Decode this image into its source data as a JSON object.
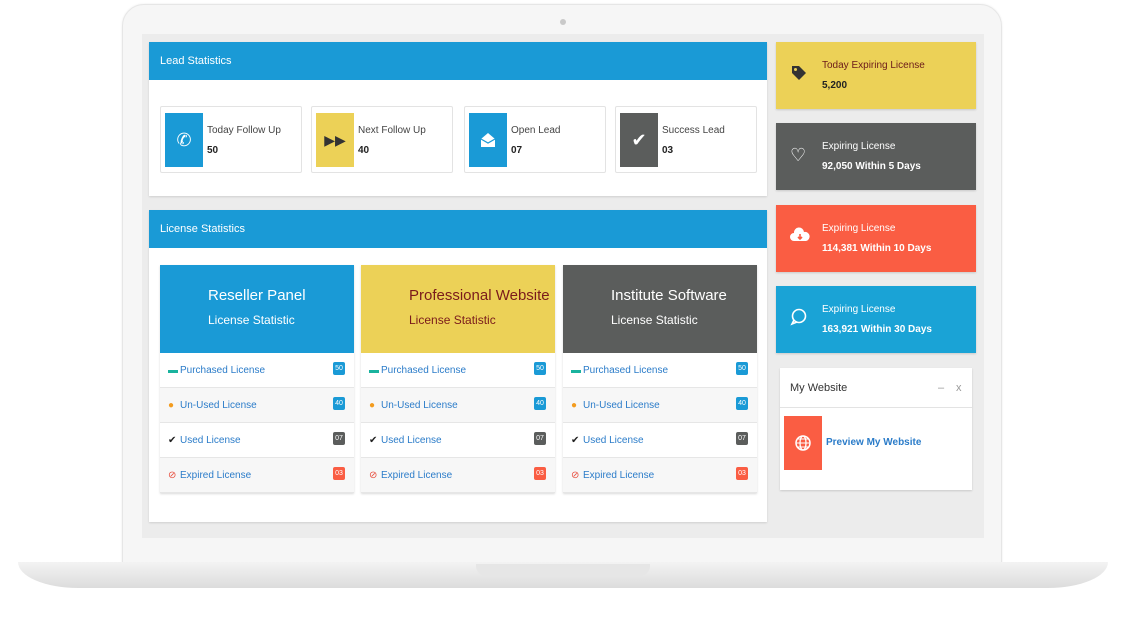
{
  "lead": {
    "title": "Lead Statistics",
    "cards": [
      {
        "label": "Today Follow Up",
        "value": "50",
        "icon": "phone-icon",
        "color": "#1a9ad6"
      },
      {
        "label": "Next Follow Up",
        "value": "40",
        "icon": "fast-forward-icon",
        "color": "#ecd157"
      },
      {
        "label": "Open Lead",
        "value": "07",
        "icon": "envelope-open-icon",
        "color": "#1a9ad6"
      },
      {
        "label": "Success Lead",
        "value": "03",
        "icon": "check-icon",
        "color": "#5b5d5c"
      }
    ]
  },
  "license": {
    "title": "License Statistics",
    "columns": [
      {
        "name": "Reseller Panel",
        "sub": "License Statistic",
        "color": "#1a9ad6",
        "rows": [
          {
            "label": "Purchased License",
            "count": "50"
          },
          {
            "label": "Un-Used License",
            "count": "40"
          },
          {
            "label": "Used License",
            "count": "07"
          },
          {
            "label": "Expired License",
            "count": "03"
          }
        ]
      },
      {
        "name": "Professional Website",
        "sub": "License Statistic",
        "color": "#ecd157",
        "rows": [
          {
            "label": "Purchased License",
            "count": "50"
          },
          {
            "label": "Un-Used License",
            "count": "40"
          },
          {
            "label": "Used License",
            "count": "07"
          },
          {
            "label": "Expired License",
            "count": "03"
          }
        ]
      },
      {
        "name": "Institute Software",
        "sub": "License Statistic",
        "color": "#5b5d5c",
        "rows": [
          {
            "label": "Purchased License",
            "count": "50"
          },
          {
            "label": "Un-Used License",
            "count": "40"
          },
          {
            "label": "Used License",
            "count": "07"
          },
          {
            "label": "Expired License",
            "count": "03"
          }
        ]
      }
    ]
  },
  "side": [
    {
      "title": "Today Expiring License",
      "value": "5,200",
      "icon": "tag-icon",
      "color": "#ecd157"
    },
    {
      "title": "Expiring License",
      "value": "92,050 Within 5 Days",
      "icon": "heart-icon",
      "color": "#5b5d5c"
    },
    {
      "title": "Expiring License",
      "value": "114,381 Within 10 Days",
      "icon": "cloud-download-icon",
      "color": "#fa5d43"
    },
    {
      "title": "Expiring License",
      "value": "163,921 Within 30 Days",
      "icon": "chat-bubble-icon",
      "color": "#1aa3d6"
    }
  ],
  "website": {
    "title": "My Website",
    "minimize": "–",
    "close": "x",
    "link": "Preview My Website",
    "icon": "globe-icon"
  },
  "colors": {
    "purchased": "#1a9ad6",
    "unused": "#1a9ad6",
    "used": "#5b5d5c",
    "expired": "#fa5d43"
  }
}
